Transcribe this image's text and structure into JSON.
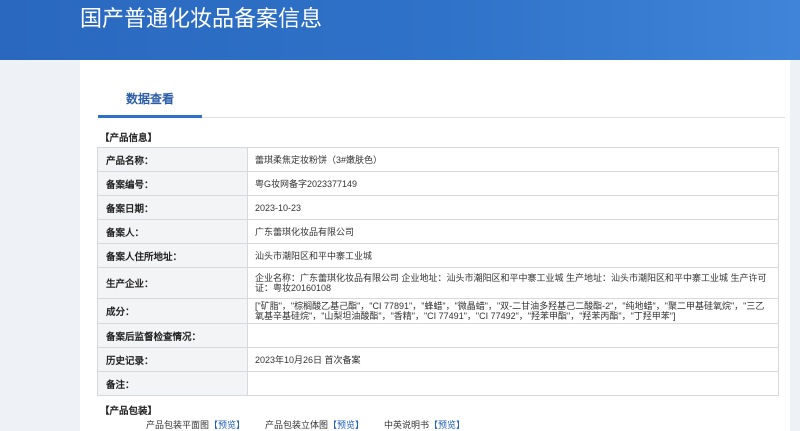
{
  "header": {
    "title": "国产普通化妆品备案信息"
  },
  "tabs": [
    {
      "label": "数据查看"
    }
  ],
  "product_info": {
    "section_title": "【产品信息】",
    "rows": [
      {
        "label": "产品名称：",
        "value": "蕾琪柔焦定妆粉饼（3#嫩肤色）"
      },
      {
        "label": "备案编号：",
        "value": "粤G妆网备字2023377149"
      },
      {
        "label": "备案日期：",
        "value": "2023-10-23"
      },
      {
        "label": "备案人：",
        "value": "广东蕾琪化妆品有限公司"
      },
      {
        "label": "备案人住所地址：",
        "value": "汕头市潮阳区和平中寨工业城"
      },
      {
        "label": "生产企业：",
        "value": "企业名称：广东蕾琪化妆品有限公司 企业地址：汕头市潮阳区和平中寨工业城 生产地址：汕头市潮阳区和平中寨工业城 生产许可证：粤妆20160108"
      },
      {
        "label": "成分：",
        "value": "[\"矿脂\"，\"棕榈酸乙基己酯\"，\"CI 77891\"，\"蜂蜡\"，\"微晶蜡\"，\"双-二甘油多羟基己二酸酯-2\"，\"纯地蜡\"，\"聚二甲基硅氧烷\"，\"三乙氧基辛基硅烷\"，\"山梨坦油酸酯\"，\"香精\"，\"CI 77491\"，\"CI 77492\"，\"羟苯甲酯\"，\"羟苯丙酯\"，\"丁羟甲苯\"]"
      },
      {
        "label": "备案后监督检查情况：",
        "value": ""
      },
      {
        "label": "历史记录：",
        "value": "2023年10月26日 首次备案"
      },
      {
        "label": "备注：",
        "value": ""
      }
    ]
  },
  "packaging": {
    "section_title": "【产品包装】",
    "items": [
      {
        "label": "产品包装平面图",
        "link": "【预览】"
      },
      {
        "label": "产品包装立体图",
        "link": "【预览】"
      },
      {
        "label": "中英说明书",
        "link": "【预览】"
      }
    ]
  },
  "colors": {
    "header_blue": "#2f72c9",
    "tab_accent": "#2e6fc8",
    "link_blue": "#1f5fbf",
    "label_bg": "#f3f4f6"
  }
}
